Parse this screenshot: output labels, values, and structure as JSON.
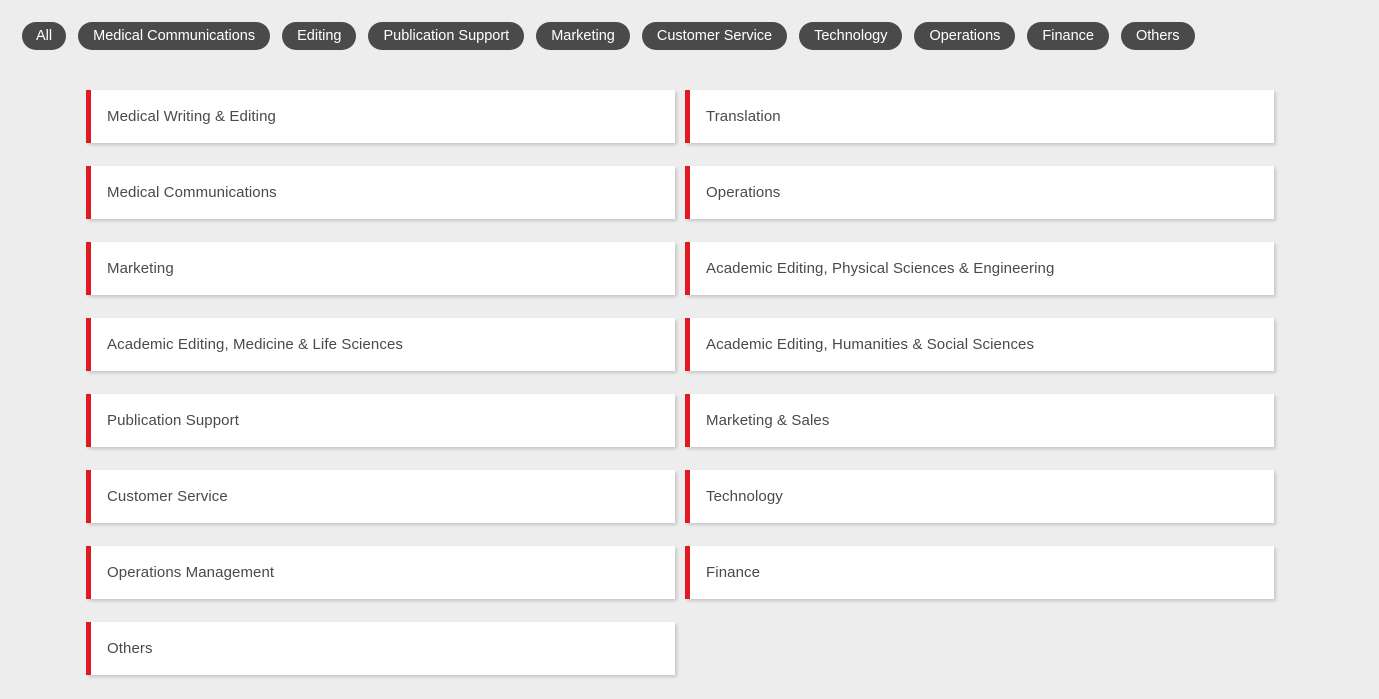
{
  "theme": {
    "page_background": "#ededed",
    "pill_background": "#4a4a4a",
    "pill_text": "#ffffff",
    "card_background": "#ffffff",
    "card_accent": "#e01a22",
    "card_text": "#4a4a4a"
  },
  "filter_bar": {
    "tabs": [
      {
        "label": "All"
      },
      {
        "label": "Medical Communications"
      },
      {
        "label": "Editing"
      },
      {
        "label": "Publication Support"
      },
      {
        "label": "Marketing"
      },
      {
        "label": "Customer Service"
      },
      {
        "label": "Technology"
      },
      {
        "label": "Operations"
      },
      {
        "label": "Finance"
      },
      {
        "label": "Others"
      }
    ]
  },
  "card_grid": {
    "left_column": [
      {
        "label": "Medical Writing & Editing"
      },
      {
        "label": "Medical Communications"
      },
      {
        "label": "Marketing"
      },
      {
        "label": "Academic Editing, Medicine & Life Sciences"
      },
      {
        "label": "Publication Support"
      },
      {
        "label": "Customer Service"
      },
      {
        "label": "Operations Management"
      },
      {
        "label": "Others"
      }
    ],
    "right_column": [
      {
        "label": "Translation"
      },
      {
        "label": "Operations"
      },
      {
        "label": "Academic Editing, Physical Sciences & Engineering"
      },
      {
        "label": "Academic Editing, Humanities & Social Sciences"
      },
      {
        "label": "Marketing & Sales"
      },
      {
        "label": "Technology"
      },
      {
        "label": "Finance"
      }
    ]
  }
}
